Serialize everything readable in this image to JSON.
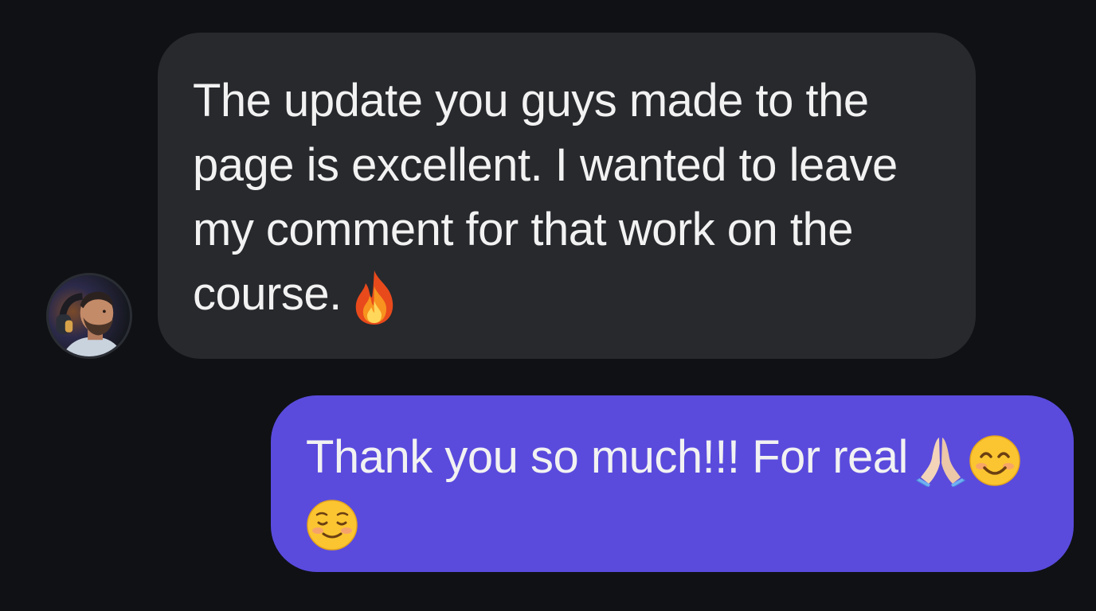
{
  "conversation": {
    "incoming": {
      "lines": [
        "The update you guys made to the",
        "page is excellent. I wanted to leave",
        "my comment for that work on the",
        "course."
      ],
      "trailing_emoji": "fire-emoji"
    },
    "outgoing": {
      "lines": [
        "Thank you so much!!! For real",
        ""
      ],
      "emojis": [
        "folded-hands-emoji",
        "smiling-face-with-smiling-eyes-emoji",
        "smiling-face-emoji"
      ]
    }
  },
  "colors": {
    "background": "#0f1115",
    "incoming_bubble": "#27292d",
    "outgoing_bubble": "#5a4bdd",
    "text": "#f2f2f2"
  }
}
